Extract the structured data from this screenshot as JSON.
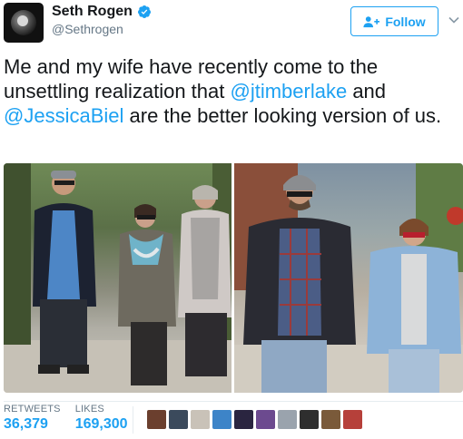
{
  "user": {
    "display_name": "Seth Rogen",
    "screen_name": "@Sethrogen",
    "verified": true,
    "avatar_icon": "avatar-image"
  },
  "follow_button": {
    "label": "Follow",
    "icon": "add-user-icon",
    "color": "#1da1f2"
  },
  "tweet": {
    "text_segments": [
      {
        "text": "Me and my wife have recently come to the unsettling realization that ",
        "type": "text"
      },
      {
        "text": "@jtimberlake",
        "type": "mention"
      },
      {
        "text": " and ",
        "type": "text"
      },
      {
        "text": "@JessicaBiel",
        "type": "mention"
      },
      {
        "text": " are the better looking version of us.",
        "type": "text"
      }
    ]
  },
  "media": {
    "photos": [
      {
        "name": "photo-left"
      },
      {
        "name": "photo-right"
      }
    ]
  },
  "stats": {
    "retweets_label": "RETWEETS",
    "retweets_value": "36,379",
    "likes_label": "LIKES",
    "likes_value": "169,300"
  },
  "likers": [
    {
      "color": "#6b3f2e"
    },
    {
      "color": "#3b4a5c"
    },
    {
      "color": "#c9c2b8"
    },
    {
      "color": "#3d84c8"
    },
    {
      "color": "#2a2540"
    },
    {
      "color": "#6c4a8f"
    },
    {
      "color": "#9aa3ad"
    },
    {
      "color": "#2e2e2e"
    },
    {
      "color": "#7a5a3a"
    },
    {
      "color": "#b6403a"
    }
  ],
  "colors": {
    "accent": "#1da1f2",
    "muted": "#657786",
    "text": "#14171a"
  }
}
